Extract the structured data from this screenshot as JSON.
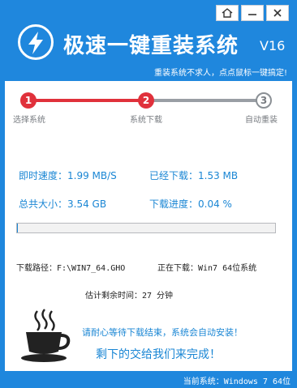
{
  "app": {
    "title": "极速一键重装系统",
    "version": "V16",
    "slogan": "重装系统不求人，点点鼠标一键搞定!",
    "logo_icon": "lightning-bolt-icon"
  },
  "window_controls": {
    "home_icon": "home-icon",
    "minimize_icon": "minimize-icon",
    "close_icon": "close-icon"
  },
  "steps": [
    {
      "number": "1",
      "label": "选择系统"
    },
    {
      "number": "2",
      "label": "系统下载"
    },
    {
      "number": "3",
      "label": "自动重装"
    }
  ],
  "stats": {
    "speed": "即时速度：1.99 MB/S",
    "downloaded": "已经下载：1.53 MB",
    "total_size": "总共大小：3.54 GB",
    "progress_text": "下载进度：0.04 %"
  },
  "progress": {
    "percent": 0.04
  },
  "details": {
    "path": "下载路径：F:\\WIN7_64.GHO",
    "downloading": "正在下载：Win7 64位系统",
    "remaining": "估计剩余时间：27 分钟"
  },
  "messages": {
    "wait": "请耐心等待下载结束，系统会自动安装！",
    "leave_it": "剩下的交给我们来完成！",
    "cup_icon": "coffee-cup-icon"
  },
  "footer": {
    "current_system": "当前系统：Windows 7 64位"
  },
  "colors": {
    "brand_blue": "#1f87dd",
    "accent_red": "#e0313b",
    "text_blue": "#1a86d4"
  }
}
